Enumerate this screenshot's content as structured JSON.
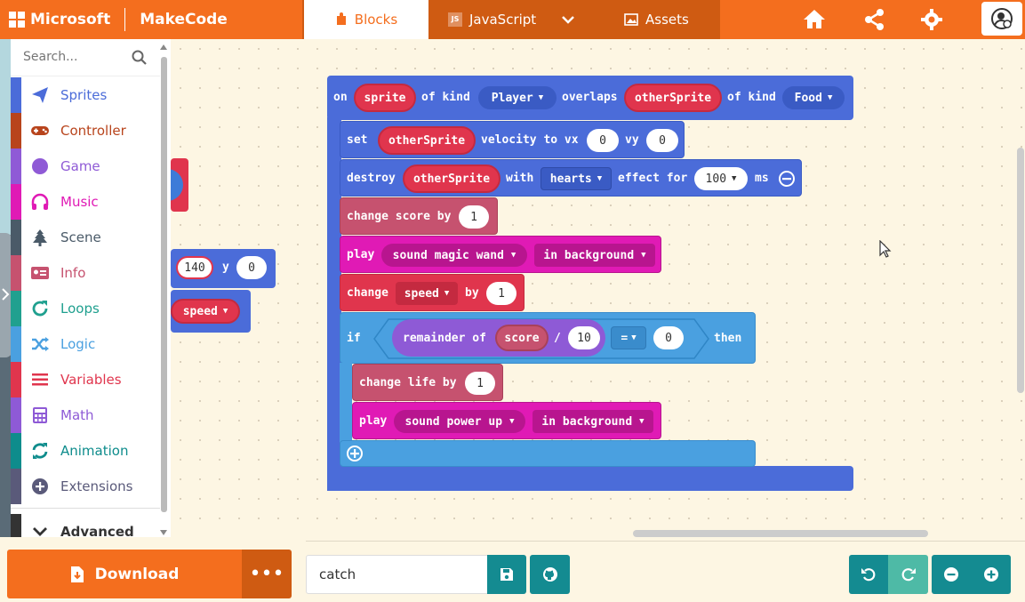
{
  "header": {
    "brand_microsoft": "Microsoft",
    "brand_makecode": "MakeCode",
    "tabs": [
      {
        "label": "Blocks",
        "icon": "puzzle-icon",
        "active": true
      },
      {
        "label": "JavaScript",
        "icon": "js-icon",
        "active": false
      },
      {
        "label": "Assets",
        "icon": "image-icon",
        "active": false
      }
    ],
    "accent": "#f46e1e"
  },
  "toolbox": {
    "search_placeholder": "Search...",
    "categories": [
      {
        "label": "Sprites",
        "color": "#4b6cd9"
      },
      {
        "label": "Controller",
        "color": "#b8441c"
      },
      {
        "label": "Game",
        "color": "#8f5ad6"
      },
      {
        "label": "Music",
        "color": "#e01ab5"
      },
      {
        "label": "Scene",
        "color": "#4a5a68"
      },
      {
        "label": "Info",
        "color": "#c6526f"
      },
      {
        "label": "Loops",
        "color": "#20a08f"
      },
      {
        "label": "Logic",
        "color": "#4aa0e0"
      },
      {
        "label": "Variables",
        "color": "#e0354d"
      },
      {
        "label": "Math",
        "color": "#8e5ad6"
      },
      {
        "label": "Animation",
        "color": "#0e8c8c"
      },
      {
        "label": "Extensions",
        "color": "#5a5a7a"
      },
      {
        "label": "Advanced",
        "color": "#333333"
      }
    ]
  },
  "workspace": {
    "event_block": {
      "on": "on",
      "sprite": "sprite",
      "of_kind_1": "of kind",
      "kind1": "Player",
      "overlaps": "overlaps",
      "other": "otherSprite",
      "of_kind_2": "of kind",
      "kind2": "Food"
    },
    "set_block": {
      "set": "set",
      "var": "otherSprite",
      "velocity": "velocity to vx",
      "vx": "0",
      "vy_label": "vy",
      "vy": "0"
    },
    "destroy_block": {
      "destroy": "destroy",
      "var": "otherSprite",
      "with": "with",
      "effect": "hearts",
      "effect_for": "effect for",
      "ms_value": "100",
      "ms": "ms"
    },
    "change_score": {
      "label": "change score by",
      "value": "1"
    },
    "play1": {
      "play": "play",
      "sound": "sound magic wand",
      "mode": "in background"
    },
    "change_speed": {
      "change": "change",
      "var": "speed",
      "by": "by",
      "value": "1"
    },
    "if_block": {
      "if": "if",
      "remainder": "remainder of",
      "score": "score",
      "slash": "/",
      "divisor": "10",
      "op": "=",
      "compare": "0",
      "then": "then"
    },
    "change_life": {
      "label": "change life by",
      "value": "1"
    },
    "play2": {
      "play": "play",
      "sound": "sound power up",
      "mode": "in background"
    },
    "partial_left": {
      "x_value": "140",
      "y_label": "y",
      "y_value": "0",
      "speed": "speed"
    }
  },
  "bottom": {
    "download_label": "Download",
    "more_label": "•••",
    "project_name": "catch"
  }
}
